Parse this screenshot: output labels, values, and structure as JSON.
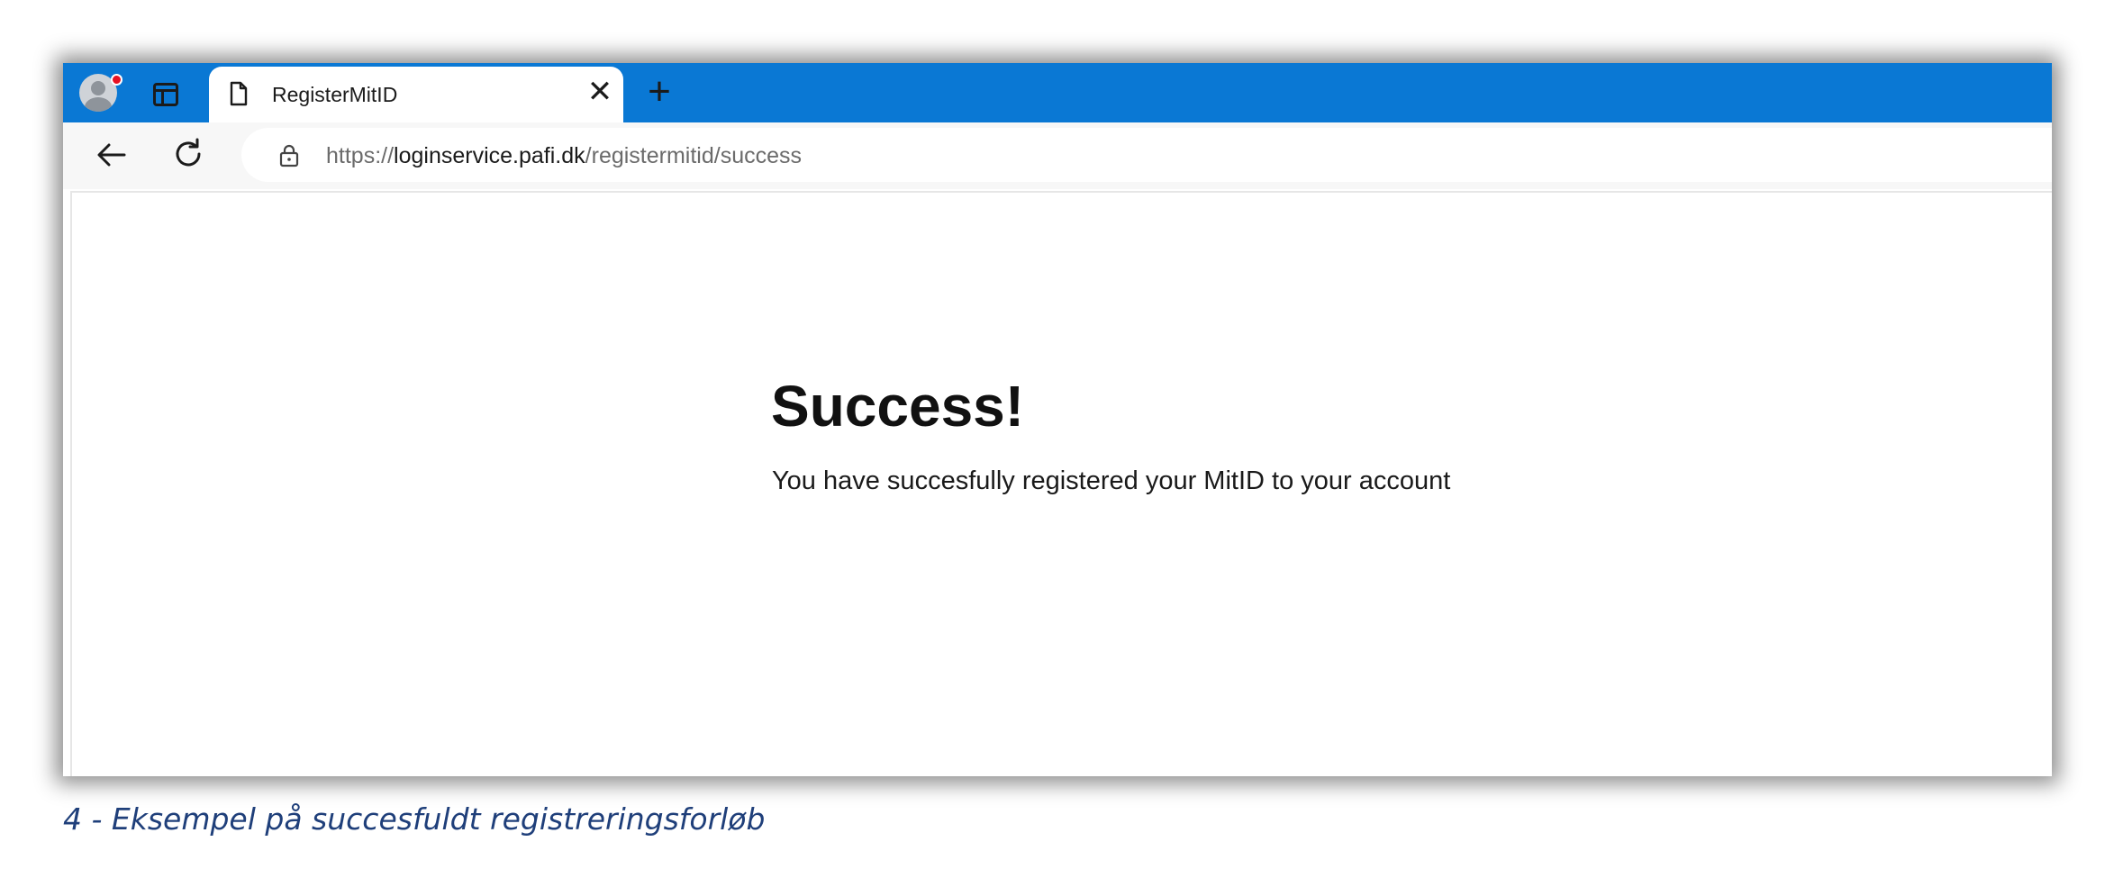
{
  "browser": {
    "tab": {
      "title": "RegisterMitID",
      "close_glyph": "✕"
    },
    "new_tab_glyph": "+",
    "address": {
      "scheme": "https://",
      "host": "loginservice.pafi.dk",
      "path": "/registermitid/success"
    },
    "icons": {
      "profile": "profile-avatar-icon",
      "tabs": "vertical-tabs-icon",
      "page": "page-document-icon",
      "back": "back-arrow-icon",
      "reload": "reload-icon",
      "site_info": "lock-icon"
    },
    "accent_color": "#0a78d4"
  },
  "page": {
    "heading": "Success!",
    "message": "You have succesfully registered your MitID to your account"
  },
  "caption": "4 - Eksempel på succesfuldt registreringsforløb"
}
